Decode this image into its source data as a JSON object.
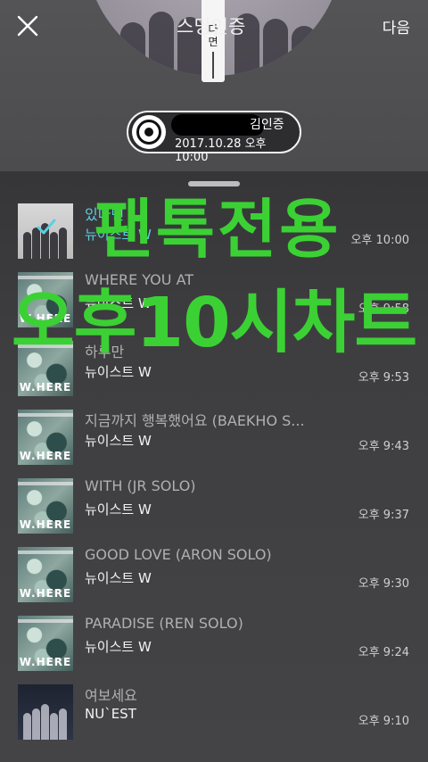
{
  "header": {
    "title": "스밍인증",
    "next_label": "다음",
    "disc_tag": [
      "다",
      "면"
    ]
  },
  "auth": {
    "name": "김인증",
    "datetime": "2017.10.28 오후 10:00"
  },
  "overlay": {
    "line1": "팬톡전용",
    "line2": "오후10시차트"
  },
  "tracks": [
    {
      "title": "있다면",
      "artist": "뉴이스트 W",
      "time": "오후 10:00",
      "art": "gray",
      "selected": true
    },
    {
      "title": "WHERE YOU AT",
      "artist": "뉴이스트 W",
      "time": "오후 9:58",
      "art": "where",
      "selected": false
    },
    {
      "title": "하루만",
      "artist": "뉴이스트 W",
      "time": "오후 9:53",
      "art": "where",
      "selected": false
    },
    {
      "title": "지금까지 행복했어요 (BAEKHO S...",
      "artist": "뉴이스트 W",
      "time": "오후 9:43",
      "art": "where",
      "selected": false
    },
    {
      "title": "WITH (JR SOLO)",
      "artist": "뉴이스트 W",
      "time": "오후 9:37",
      "art": "where",
      "selected": false
    },
    {
      "title": "GOOD LOVE (ARON SOLO)",
      "artist": "뉴이스트 W",
      "time": "오후 9:30",
      "art": "where",
      "selected": false
    },
    {
      "title": "PARADISE (REN SOLO)",
      "artist": "뉴이스트 W",
      "time": "오후 9:24",
      "art": "where",
      "selected": false
    },
    {
      "title": "여보세요",
      "artist": "NU`EST",
      "time": "오후 9:10",
      "art": "dark",
      "selected": false
    }
  ],
  "album_watermark": "W.HERE",
  "colors": {
    "overlay_green": "#3bd134",
    "selected_cyan": "#5ad0e3",
    "background": "#3f3f41"
  },
  "icons": {
    "close": "close-icon",
    "disc": "disc-icon",
    "check": "check-icon"
  }
}
